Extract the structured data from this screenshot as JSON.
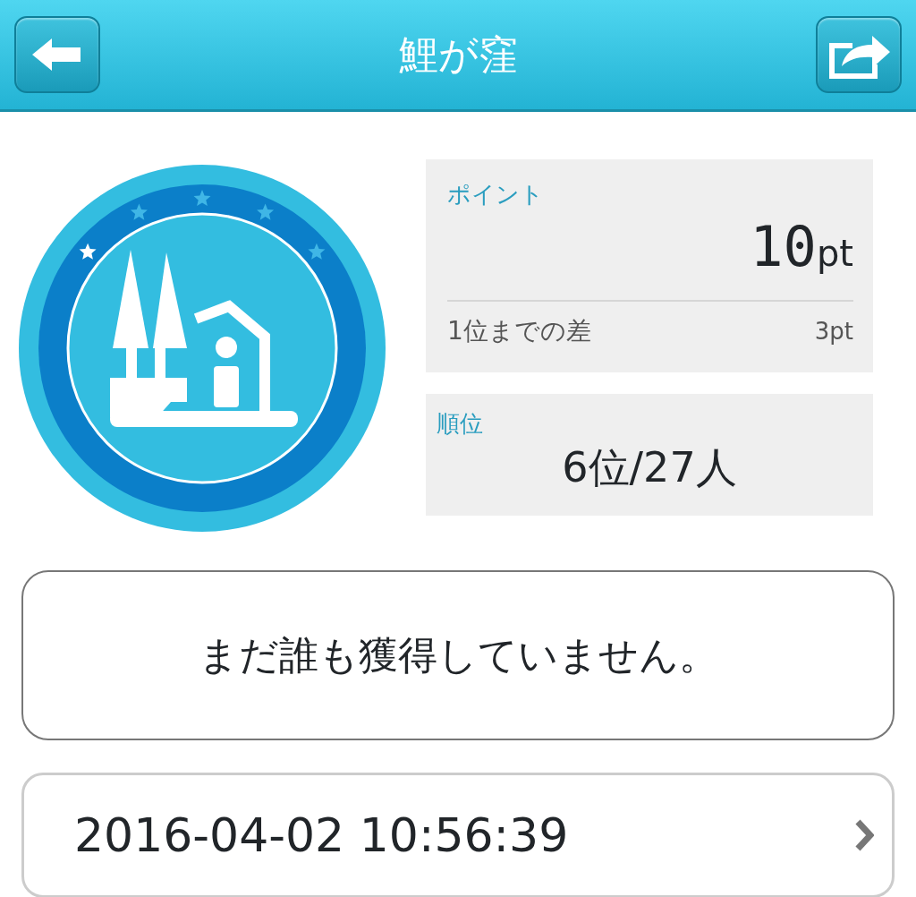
{
  "header": {
    "title": "鯉が窪"
  },
  "points": {
    "label": "ポイント",
    "value": "10",
    "unit": "pt",
    "gap_label": "1位までの差",
    "gap_value": "3pt"
  },
  "rank": {
    "label": "順位",
    "value": "6位/27人"
  },
  "message": "まだ誰も獲得していません。",
  "history": [
    {
      "timestamp": "2016-04-02 10:56:39"
    }
  ]
}
